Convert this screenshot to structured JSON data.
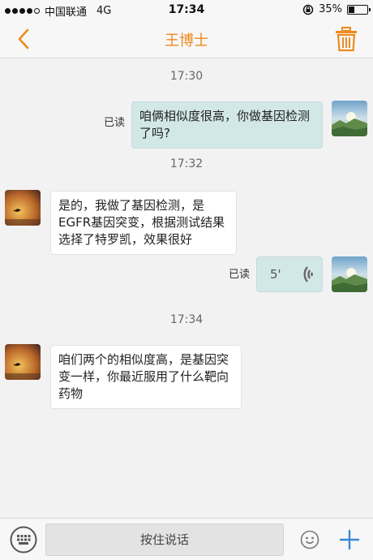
{
  "status_bar": {
    "carrier": "中国联通",
    "network": "4G",
    "time": "17:34",
    "battery": "35%",
    "battery_level": 0.35
  },
  "header": {
    "title": "王博士",
    "back_icon": "chevron-left-icon",
    "trash_icon": "trash-icon"
  },
  "colors": {
    "accent": "#ee8a1e",
    "sent_bubble": "#d2e8e7",
    "received_bubble": "#ffffff",
    "send_plus": "#3a86d8"
  },
  "messages": {
    "t1": "17:30",
    "m1_read": "已读",
    "m1_text": "咱俩相似度很高，你做基因检测了吗?",
    "t2": "17:32",
    "m2_text": "是的，我做了基因检测，是EGFR基因突变，根据测试结果选择了特罗凯，效果很好",
    "m3_read": "已读",
    "m3_duration": "5'",
    "t3": "17:34",
    "m4_text": "咱们两个的相似度高，是基因突变一样，你最近服用了什么靶向药物"
  },
  "input_bar": {
    "hold_to_talk": "按住说话",
    "keyboard_icon": "keyboard-icon",
    "emoji_icon": "emoji-icon",
    "plus_icon": "plus-icon"
  }
}
